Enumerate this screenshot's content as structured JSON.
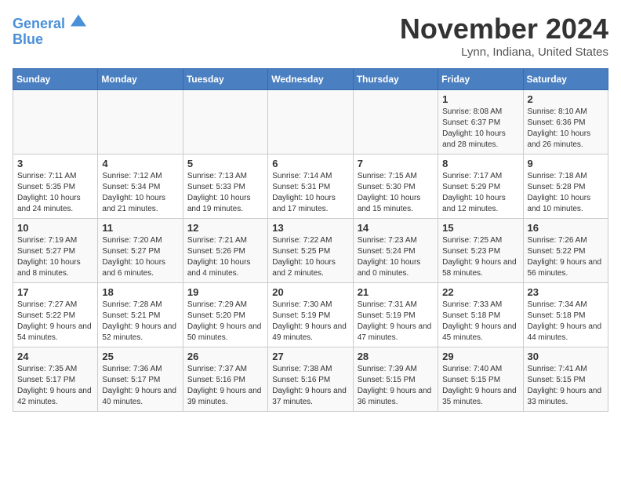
{
  "header": {
    "logo_line1": "General",
    "logo_line2": "Blue",
    "month_title": "November 2024",
    "location": "Lynn, Indiana, United States"
  },
  "days_of_week": [
    "Sunday",
    "Monday",
    "Tuesday",
    "Wednesday",
    "Thursday",
    "Friday",
    "Saturday"
  ],
  "weeks": [
    [
      {
        "num": "",
        "info": ""
      },
      {
        "num": "",
        "info": ""
      },
      {
        "num": "",
        "info": ""
      },
      {
        "num": "",
        "info": ""
      },
      {
        "num": "",
        "info": ""
      },
      {
        "num": "1",
        "info": "Sunrise: 8:08 AM\nSunset: 6:37 PM\nDaylight: 10 hours and 28 minutes."
      },
      {
        "num": "2",
        "info": "Sunrise: 8:10 AM\nSunset: 6:36 PM\nDaylight: 10 hours and 26 minutes."
      }
    ],
    [
      {
        "num": "3",
        "info": "Sunrise: 7:11 AM\nSunset: 5:35 PM\nDaylight: 10 hours and 24 minutes."
      },
      {
        "num": "4",
        "info": "Sunrise: 7:12 AM\nSunset: 5:34 PM\nDaylight: 10 hours and 21 minutes."
      },
      {
        "num": "5",
        "info": "Sunrise: 7:13 AM\nSunset: 5:33 PM\nDaylight: 10 hours and 19 minutes."
      },
      {
        "num": "6",
        "info": "Sunrise: 7:14 AM\nSunset: 5:31 PM\nDaylight: 10 hours and 17 minutes."
      },
      {
        "num": "7",
        "info": "Sunrise: 7:15 AM\nSunset: 5:30 PM\nDaylight: 10 hours and 15 minutes."
      },
      {
        "num": "8",
        "info": "Sunrise: 7:17 AM\nSunset: 5:29 PM\nDaylight: 10 hours and 12 minutes."
      },
      {
        "num": "9",
        "info": "Sunrise: 7:18 AM\nSunset: 5:28 PM\nDaylight: 10 hours and 10 minutes."
      }
    ],
    [
      {
        "num": "10",
        "info": "Sunrise: 7:19 AM\nSunset: 5:27 PM\nDaylight: 10 hours and 8 minutes."
      },
      {
        "num": "11",
        "info": "Sunrise: 7:20 AM\nSunset: 5:27 PM\nDaylight: 10 hours and 6 minutes."
      },
      {
        "num": "12",
        "info": "Sunrise: 7:21 AM\nSunset: 5:26 PM\nDaylight: 10 hours and 4 minutes."
      },
      {
        "num": "13",
        "info": "Sunrise: 7:22 AM\nSunset: 5:25 PM\nDaylight: 10 hours and 2 minutes."
      },
      {
        "num": "14",
        "info": "Sunrise: 7:23 AM\nSunset: 5:24 PM\nDaylight: 10 hours and 0 minutes."
      },
      {
        "num": "15",
        "info": "Sunrise: 7:25 AM\nSunset: 5:23 PM\nDaylight: 9 hours and 58 minutes."
      },
      {
        "num": "16",
        "info": "Sunrise: 7:26 AM\nSunset: 5:22 PM\nDaylight: 9 hours and 56 minutes."
      }
    ],
    [
      {
        "num": "17",
        "info": "Sunrise: 7:27 AM\nSunset: 5:22 PM\nDaylight: 9 hours and 54 minutes."
      },
      {
        "num": "18",
        "info": "Sunrise: 7:28 AM\nSunset: 5:21 PM\nDaylight: 9 hours and 52 minutes."
      },
      {
        "num": "19",
        "info": "Sunrise: 7:29 AM\nSunset: 5:20 PM\nDaylight: 9 hours and 50 minutes."
      },
      {
        "num": "20",
        "info": "Sunrise: 7:30 AM\nSunset: 5:19 PM\nDaylight: 9 hours and 49 minutes."
      },
      {
        "num": "21",
        "info": "Sunrise: 7:31 AM\nSunset: 5:19 PM\nDaylight: 9 hours and 47 minutes."
      },
      {
        "num": "22",
        "info": "Sunrise: 7:33 AM\nSunset: 5:18 PM\nDaylight: 9 hours and 45 minutes."
      },
      {
        "num": "23",
        "info": "Sunrise: 7:34 AM\nSunset: 5:18 PM\nDaylight: 9 hours and 44 minutes."
      }
    ],
    [
      {
        "num": "24",
        "info": "Sunrise: 7:35 AM\nSunset: 5:17 PM\nDaylight: 9 hours and 42 minutes."
      },
      {
        "num": "25",
        "info": "Sunrise: 7:36 AM\nSunset: 5:17 PM\nDaylight: 9 hours and 40 minutes."
      },
      {
        "num": "26",
        "info": "Sunrise: 7:37 AM\nSunset: 5:16 PM\nDaylight: 9 hours and 39 minutes."
      },
      {
        "num": "27",
        "info": "Sunrise: 7:38 AM\nSunset: 5:16 PM\nDaylight: 9 hours and 37 minutes."
      },
      {
        "num": "28",
        "info": "Sunrise: 7:39 AM\nSunset: 5:15 PM\nDaylight: 9 hours and 36 minutes."
      },
      {
        "num": "29",
        "info": "Sunrise: 7:40 AM\nSunset: 5:15 PM\nDaylight: 9 hours and 35 minutes."
      },
      {
        "num": "30",
        "info": "Sunrise: 7:41 AM\nSunset: 5:15 PM\nDaylight: 9 hours and 33 minutes."
      }
    ]
  ]
}
